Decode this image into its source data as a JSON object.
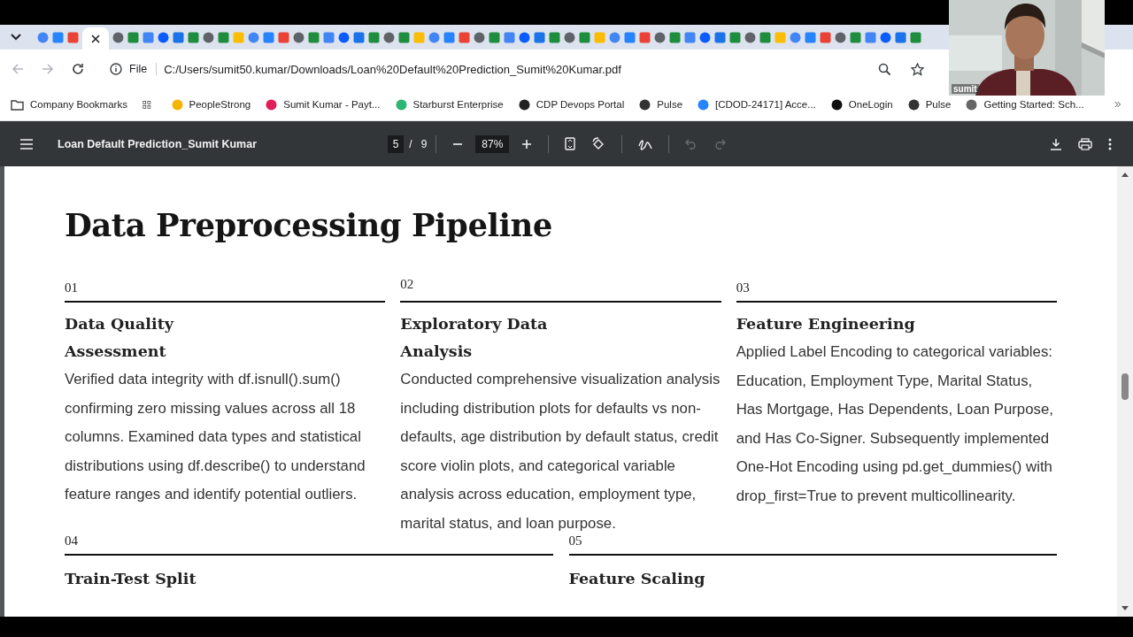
{
  "browser": {
    "address": {
      "scheme": "File",
      "url": "C:/Users/sumit50.kumar/Downloads/Loan%20Default%20Prediction_Sumit%20Kumar.pdf"
    },
    "bookmarks": [
      {
        "kind": "folder",
        "label": "Company Bookmarks"
      },
      {
        "kind": "apps"
      },
      {
        "kind": "site",
        "label": "PeopleStrong",
        "color": "#f4b400"
      },
      {
        "kind": "site",
        "label": "Sumit Kumar - Payt...",
        "color": "#e01e5a"
      },
      {
        "kind": "site",
        "label": "Starburst Enterprise",
        "color": "#2bb673"
      },
      {
        "kind": "site",
        "label": "CDP Devops Portal",
        "color": "#222222"
      },
      {
        "kind": "site",
        "label": "Pulse",
        "color": "#333333"
      },
      {
        "kind": "site",
        "label": "[CDOD-24171] Acce...",
        "color": "#2684ff"
      },
      {
        "kind": "site",
        "label": "OneLogin",
        "color": "#111111"
      },
      {
        "kind": "site",
        "label": "Pulse",
        "color": "#333333"
      },
      {
        "kind": "site",
        "label": "Getting Started: Sch...",
        "color": "#666666"
      }
    ]
  },
  "pdf_viewer": {
    "title": "Loan Default Prediction_Sumit Kumar",
    "page": "5",
    "page_separator": "/",
    "page_count": "9",
    "zoom": "87%"
  },
  "document": {
    "heading": "Data Preprocessing Pipeline",
    "steps": [
      {
        "number": "01",
        "title": "Data Quality Assessment",
        "body": "Verified data integrity with df.isnull().sum() confirming zero missing values across all 18 columns. Examined data types and statistical distributions using df.describe() to understand feature ranges and identify potential outliers."
      },
      {
        "number": "02",
        "title": "Exploratory Data Analysis",
        "body": "Conducted comprehensive visualization analysis including distribution plots for defaults vs non-defaults, age distribution by default status, credit score violin plots, and categorical variable analysis across education, employment type, marital status, and loan purpose."
      },
      {
        "number": "03",
        "title": "Feature Engineering",
        "body": "Applied Label Encoding to categorical variables: Education, Employment Type, Marital Status, Has Mortgage, Has Dependents, Loan Purpose, and Has Co-Signer. Subsequently implemented One-Hot Encoding using pd.get_dummies() with drop_first=True to prevent multicollinearity."
      }
    ],
    "next_steps": [
      {
        "number": "04",
        "title": "Train-Test Split"
      },
      {
        "number": "05",
        "title": "Feature Scaling"
      }
    ]
  },
  "webcam": {
    "kind": "picture",
    "participant": "sumit"
  }
}
